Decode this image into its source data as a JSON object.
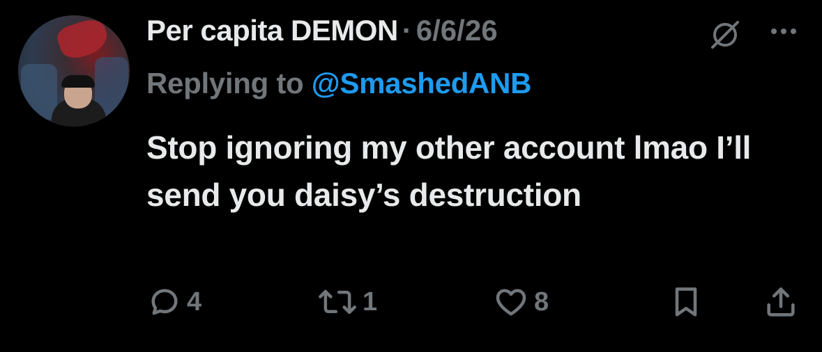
{
  "tweet": {
    "display_name": "Per capita DEMON",
    "separator": "·",
    "date": "6/6/26",
    "reply_prefix": "Replying to",
    "reply_handle": "@SmashedANB",
    "text": "Stop ignoring my other account lmao I’ll send you daisy’s destruction"
  },
  "actions": {
    "replies": "4",
    "retweets": "1",
    "likes": "8"
  },
  "icons": {
    "reply": "reply-icon",
    "retweet": "retweet-icon",
    "like": "heart-icon",
    "bookmark": "bookmark-icon",
    "share": "share-icon",
    "grok": "grok-icon",
    "more": "more-icon"
  },
  "colors": {
    "background": "#000000",
    "primary_text": "#e7e9ea",
    "secondary_text": "#71767b",
    "link": "#1d9bf0"
  }
}
